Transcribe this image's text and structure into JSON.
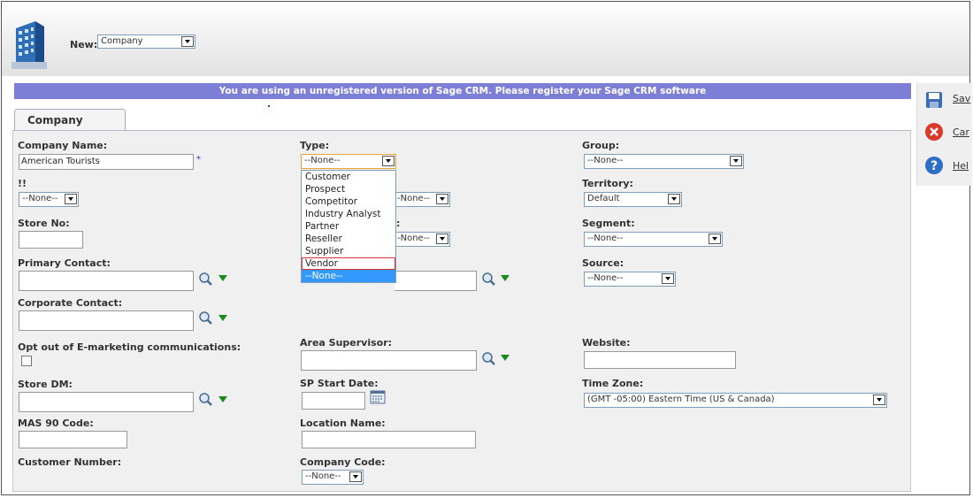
{
  "header": {
    "new_label": "New:",
    "new_select": "Company"
  },
  "banner": "You are using an unregistered version of Sage CRM. Please register your Sage CRM software",
  "tab": "Company",
  "actions": [
    {
      "label": "Sav",
      "icon": "save-icon"
    },
    {
      "label": "Car",
      "icon": "cancel-icon"
    },
    {
      "label": "Hel",
      "icon": "help-icon"
    }
  ],
  "form": {
    "company_name": {
      "label": "Company Name:",
      "value": "American Tourists",
      "required_mark": "*"
    },
    "type": {
      "label": "Type:",
      "value": "--None--"
    },
    "group": {
      "label": "Group:",
      "value": "--None--"
    },
    "bang": {
      "label": "!!",
      "value": "--None--"
    },
    "hidden_select_1": {
      "value": "-None--"
    },
    "territory": {
      "label": "Territory:",
      "value": "Default"
    },
    "store_no": {
      "label": "Store No:",
      "value": ""
    },
    "hidden_label_2": ":",
    "hidden_select_2": {
      "value": "-None--"
    },
    "segment": {
      "label": "Segment:",
      "value": "--None--"
    },
    "primary_contact": {
      "label": "Primary Contact:",
      "value": ""
    },
    "source": {
      "label": "Source:",
      "value": "--None--"
    },
    "corporate_contact": {
      "label": "Corporate Contact:",
      "value": ""
    },
    "opt_out": {
      "label": "Opt out of E-marketing communications:",
      "checked": false
    },
    "area_supervisor": {
      "label": "Area Supervisor:",
      "value": ""
    },
    "website": {
      "label": "Website:",
      "value": ""
    },
    "store_dm": {
      "label": "Store DM:",
      "value": ""
    },
    "sp_start_date": {
      "label": "SP Start Date:",
      "value": ""
    },
    "time_zone": {
      "label": "Time Zone:",
      "value": "(GMT -05:00) Eastern Time (US & Canada)"
    },
    "mas90": {
      "label": "MAS 90 Code:",
      "value": ""
    },
    "location_name": {
      "label": "Location Name:",
      "value": ""
    },
    "customer_number": {
      "label": "Customer Number:"
    },
    "company_code": {
      "label": "Company Code:",
      "value": "--None--"
    }
  },
  "type_dropdown": {
    "options": [
      "Customer",
      "Prospect",
      "Competitor",
      "Industry Analyst",
      "Partner",
      "Reseller",
      "Supplier",
      "Vendor",
      "--None--"
    ],
    "hovered": "Vendor",
    "selected": "--None--"
  },
  "colors": {
    "banner": "#7d7fd6",
    "panel": "#f0f0f0",
    "selected_option": "#3399ff",
    "required": "#3333cc",
    "triangle": "#1a8a1a"
  }
}
